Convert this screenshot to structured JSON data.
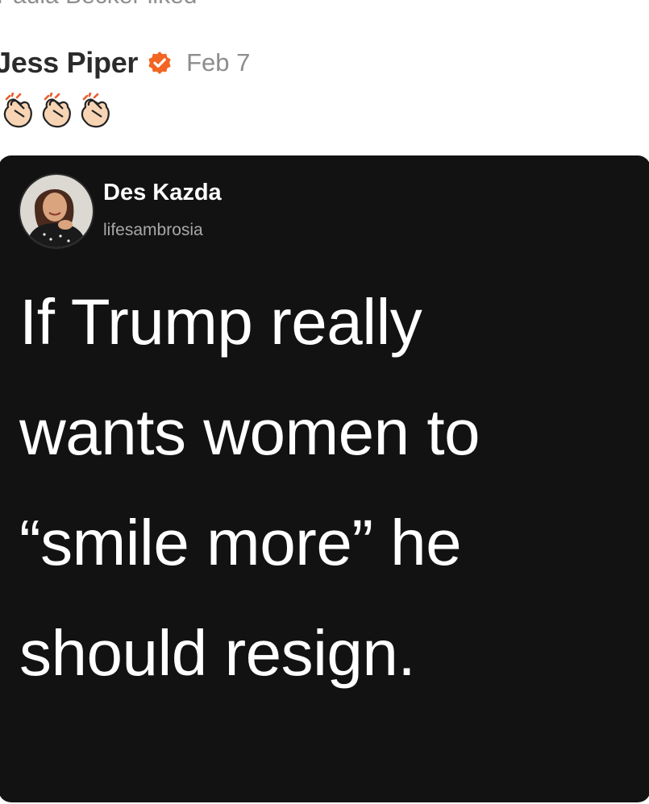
{
  "activity": {
    "text": "Paula Becker liked"
  },
  "post": {
    "author": "Jess Piper",
    "date": "Feb 7",
    "verified_icon": "verified-badge-icon",
    "emojis": [
      "clapping-hands-icon",
      "clapping-hands-icon",
      "clapping-hands-icon"
    ],
    "colors": {
      "verified": "#f26522",
      "text": "#2b2b2b",
      "muted": "#8d8d8d"
    }
  },
  "embedded_image": {
    "name": "Des Kazda",
    "handle": "lifesambrosia",
    "background": "#121212",
    "lines": [
      "If Trump really",
      "wants women to",
      "“smile more” he",
      "should resign."
    ]
  }
}
